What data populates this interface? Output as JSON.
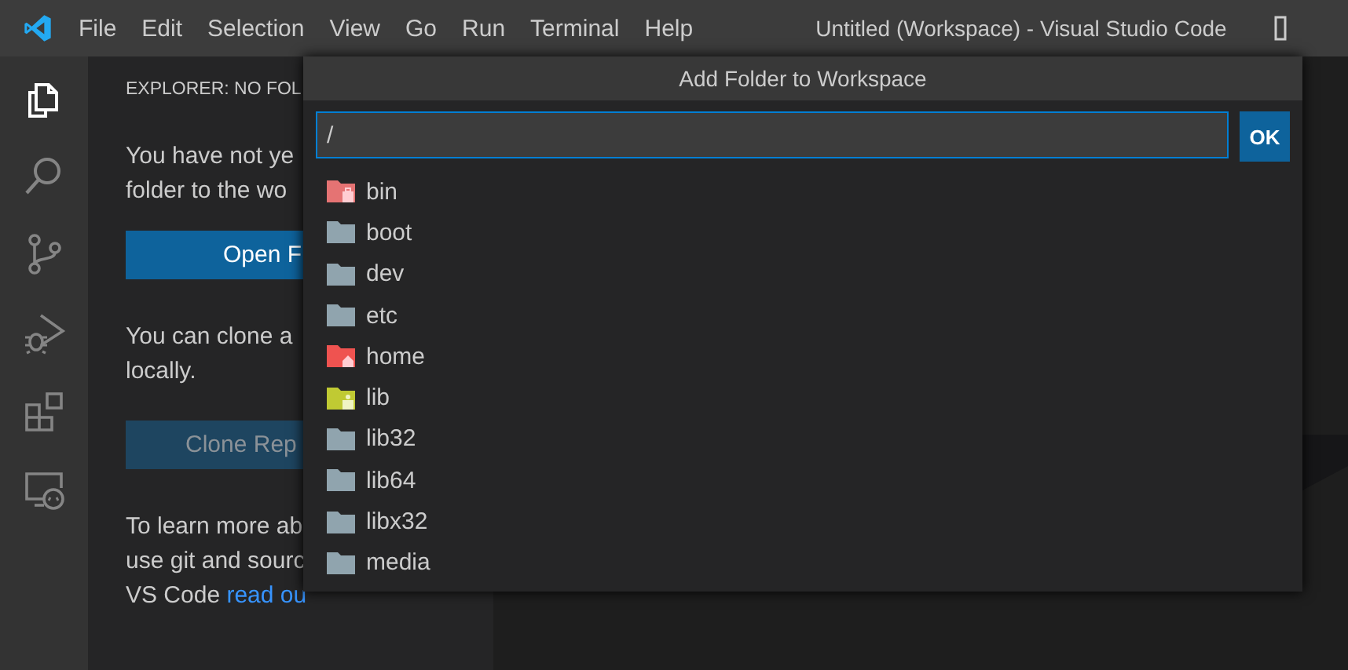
{
  "window": {
    "title": "Untitled (Workspace) - Visual Studio Code"
  },
  "menu": [
    "File",
    "Edit",
    "Selection",
    "View",
    "Go",
    "Run",
    "Terminal",
    "Help"
  ],
  "activity_bar": [
    {
      "kind": "explorer",
      "selected": true
    },
    {
      "kind": "search",
      "selected": false
    },
    {
      "kind": "source-control",
      "selected": false
    },
    {
      "kind": "run",
      "selected": false
    },
    {
      "kind": "extensions",
      "selected": false
    },
    {
      "kind": "remote",
      "selected": false
    }
  ],
  "sidebar": {
    "header": "EXPLORER: NO FOL",
    "paragraphs": [
      {
        "lines": [
          "You have not ye",
          "folder to the wo"
        ]
      },
      {
        "lines": [
          "You can clone a",
          "locally."
        ]
      },
      {
        "lines": [
          "To learn more ab",
          "use git and sourc",
          "VS Code "
        ],
        "link": "read ou"
      }
    ],
    "buttons": [
      {
        "label": "Open F",
        "disabled": false
      },
      {
        "label": "Clone Rep",
        "disabled": true
      }
    ]
  },
  "dialog": {
    "title": "Add Folder to Workspace",
    "input": {
      "value": "/"
    },
    "ok": "OK",
    "items": [
      {
        "name": "bin",
        "kind": "bin",
        "color": "#e57373"
      },
      {
        "name": "boot",
        "kind": "plain",
        "color": "#90a4ae"
      },
      {
        "name": "dev",
        "kind": "plain",
        "color": "#90a4ae"
      },
      {
        "name": "etc",
        "kind": "plain",
        "color": "#90a4ae"
      },
      {
        "name": "home",
        "kind": "home",
        "color": "#ef5350"
      },
      {
        "name": "lib",
        "kind": "lib",
        "color": "#c0ca33"
      },
      {
        "name": "lib32",
        "kind": "plain",
        "color": "#90a4ae"
      },
      {
        "name": "lib64",
        "kind": "plain",
        "color": "#90a4ae"
      },
      {
        "name": "libx32",
        "kind": "plain",
        "color": "#90a4ae"
      },
      {
        "name": "media",
        "kind": "plain",
        "color": "#90a4ae"
      }
    ]
  }
}
